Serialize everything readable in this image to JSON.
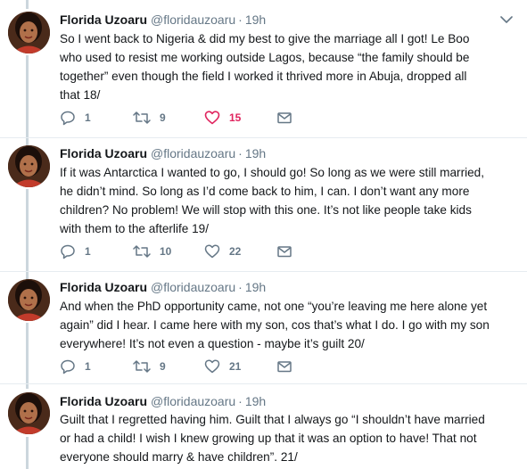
{
  "tweets": [
    {
      "name": "Florida Uzoaru",
      "handle": "@floridauzoaru",
      "separator": "·",
      "time": "19h",
      "lines": [
        "So I went back to Nigeria & did my best to give the marriage all I got! Le Boo",
        "who used to resist me working outside Lagos, because “the family should be",
        "together” even though the field I worked it thrived more in Abuja, dropped all",
        "that 18/"
      ],
      "replies": "1",
      "retweets": "9",
      "likes": "15",
      "liked": true
    },
    {
      "name": "Florida Uzoaru",
      "handle": "@floridauzoaru",
      "separator": "·",
      "time": "19h",
      "lines": [
        "If it was Antarctica I wanted to go, I should go! So long as we were still married,",
        "he didn’t mind. So long as I’d come back to him, I can. I don’t want any more",
        "children? No problem! We will stop with this one. It’s not like people take kids",
        "with them to the afterlife 19/"
      ],
      "replies": "1",
      "retweets": "10",
      "likes": "22",
      "liked": false
    },
    {
      "name": "Florida Uzoaru",
      "handle": "@floridauzoaru",
      "separator": "·",
      "time": "19h",
      "lines": [
        "And when the PhD opportunity came, not one “you’re leaving me here alone yet",
        "again” did I hear. I came here with my son, cos that’s what I do. I go with my son",
        "everywhere! It’s not even a question - maybe it’s guilt 20/"
      ],
      "replies": "1",
      "retweets": "9",
      "likes": "21",
      "liked": false
    },
    {
      "name": "Florida Uzoaru",
      "handle": "@floridauzoaru",
      "separator": "·",
      "time": "19h",
      "lines": [
        "Guilt that I regretted having him. Guilt that I always go “I shouldn’t have married",
        "or had a child! I wish I knew growing up that it was an option to have! That not",
        "everyone should marry & have children”. 21/"
      ]
    }
  ],
  "icons": {
    "reply": "reply-icon",
    "retweet": "retweet-icon",
    "like": "heart-icon",
    "message": "envelope-icon",
    "more": "chevron-down-icon"
  },
  "colors": {
    "text": "#14171a",
    "secondary": "#657786",
    "like_active": "#e0245e",
    "thread_line": "#ccd6dd",
    "divider": "#e6ecf0"
  }
}
